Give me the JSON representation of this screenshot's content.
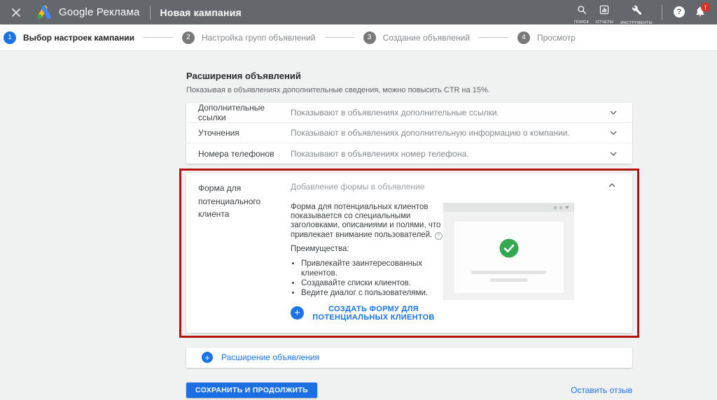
{
  "header": {
    "brand": "Google Реклама",
    "page_title": "Новая кампания",
    "nav": [
      {
        "label": "ПОИСК",
        "icon": "search-icon"
      },
      {
        "label": "ОТЧЕТЫ",
        "icon": "reports-icon"
      },
      {
        "label": "ИНСТРУМЕНТЫ И НАСТРОЙКИ",
        "icon": "tools-icon"
      }
    ],
    "help_glyph": "?",
    "notification_badge": "!"
  },
  "stepper": [
    {
      "number": "1",
      "label": "Выбор настроек кампании",
      "state": "active"
    },
    {
      "number": "2",
      "label": "Настройка групп объявлений",
      "state": "inactive"
    },
    {
      "number": "3",
      "label": "Создание объявлений",
      "state": "inactive"
    },
    {
      "number": "4",
      "label": "Просмотр",
      "state": "inactive"
    }
  ],
  "content": {
    "title": "Расширения объявлений",
    "subtitle": "Показывая в объявлениях дополнительные сведения, можно повысить CTR на 15%.",
    "extensions": [
      {
        "label": "Дополнительные ссылки",
        "desc": "Показывают в объявлениях дополнительные ссылки."
      },
      {
        "label": "Уточнения",
        "desc": "Показывают в объявлениях дополнительную информацию о компании."
      },
      {
        "label": "Номера телефонов",
        "desc": "Показывают в объявлениях номер телефона."
      }
    ],
    "lead_form": {
      "label": "Форма для потенциального клиента",
      "header": "Добавление формы в объявление",
      "description": "Форма для потенциальных клиентов показывается со специальными заголовками, описаниями и полями, что привлекает внимание пользователей.",
      "info_glyph": "?",
      "benefits_title": "Преимущества:",
      "benefits": [
        "Привлекайте заинтересованных клиентов.",
        "Создавайте списки клиентов.",
        "Ведите диалог с пользователями."
      ],
      "plus_glyph": "+",
      "create_link": "СОЗДАТЬ ФОРМУ ДЛЯ ПОТЕНЦИАЛЬНЫХ КЛИЕНТОВ"
    },
    "add_extension_plus": "+",
    "add_extension_label": "Расширение объявления",
    "save_button": "СОХРАНИТЬ И ПРОДОЛЖИТЬ",
    "feedback_link": "Оставить отзыв"
  },
  "colors": {
    "topbar_gray": "#64686d",
    "accent_blue": "#1a73e8",
    "success_green": "#34a853",
    "annotation_red": "#b3120f",
    "badge_red": "#d93025"
  }
}
